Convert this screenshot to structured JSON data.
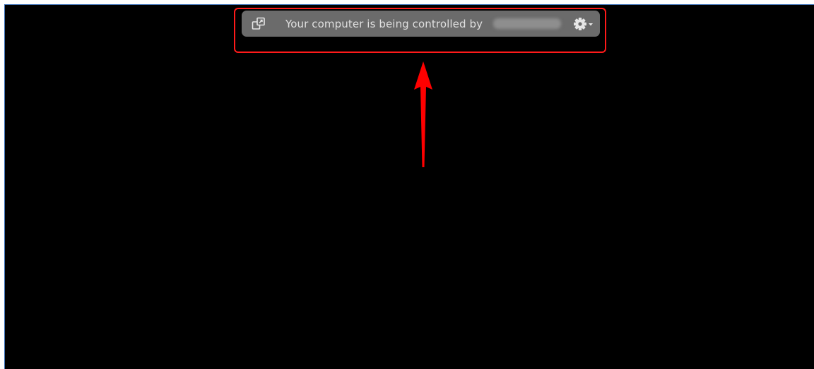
{
  "control_bar": {
    "message": "Your computer is being controlled by",
    "controller_name_redacted": true,
    "icons": {
      "app": "remote-control-icon",
      "settings": "gear-icon",
      "dropdown": "chevron-down-icon"
    }
  },
  "annotation": {
    "highlight_color": "#ff1a1a",
    "arrow_color": "#ff0000",
    "arrow_direction": "up"
  },
  "colors": {
    "screen_background": "#000000",
    "bar_background": "#6b6b6b",
    "bar_text": "#e0e0e0"
  }
}
